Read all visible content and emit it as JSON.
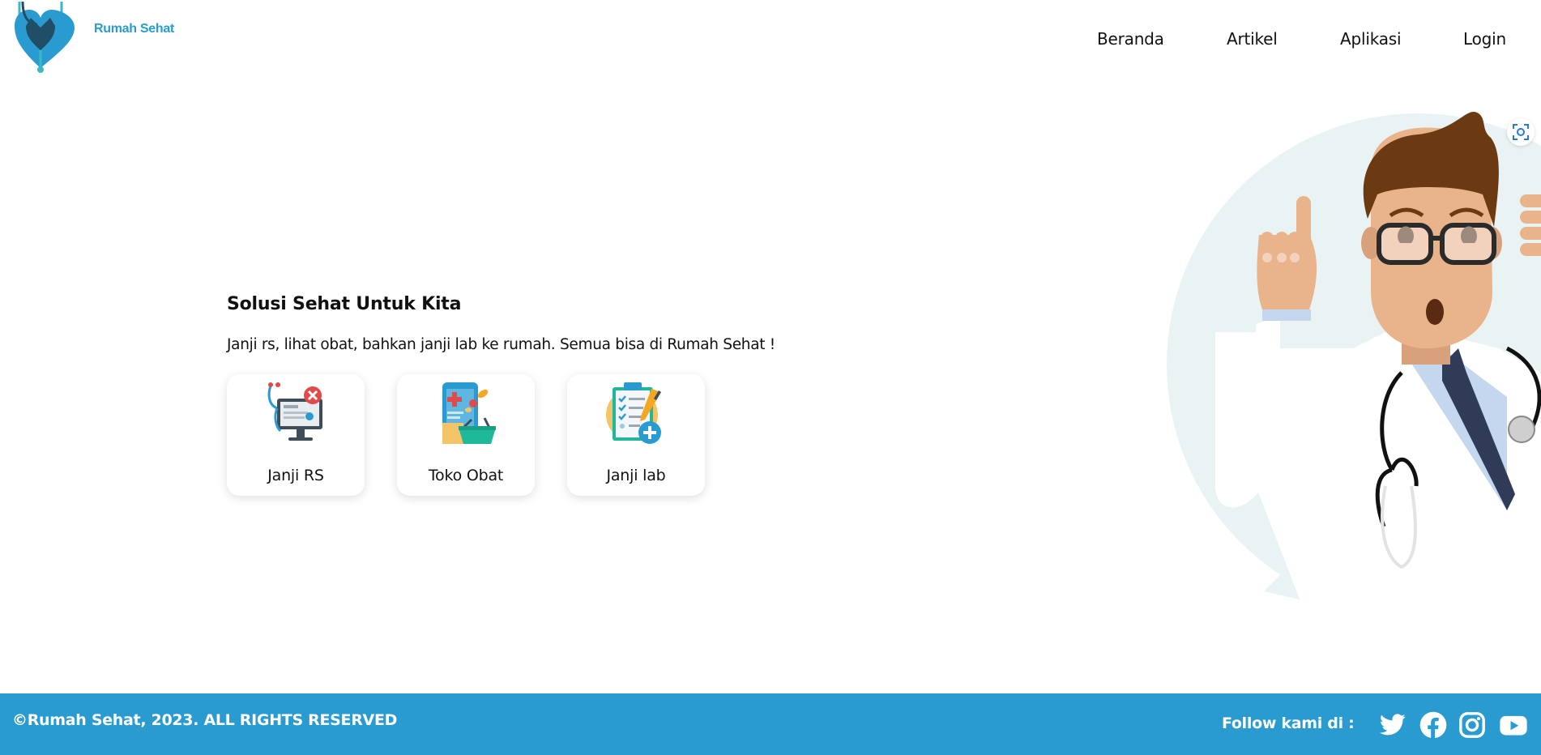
{
  "header": {
    "brand": "Rumah Sehat",
    "logo_icon": "heart-stethoscope-logo",
    "nav": [
      {
        "label": "Beranda"
      },
      {
        "label": "Artikel"
      },
      {
        "label": "Aplikasi"
      },
      {
        "label": "Login"
      }
    ]
  },
  "hero": {
    "title": "Solusi Sehat Untuk Kita",
    "subtitle": "Janji rs, lihat obat, bahkan janji lab ke rumah. Semua bisa di Rumah Sehat !",
    "illustration": "doctor-illustration",
    "services": [
      {
        "label": "Janji RS",
        "icon": "hospital-monitor-icon"
      },
      {
        "label": "Toko Obat",
        "icon": "pharmacy-basket-icon"
      },
      {
        "label": "Janji lab",
        "icon": "lab-clipboard-icon"
      }
    ]
  },
  "footer": {
    "copyright": "©Rumah Sehat, 2023. ALL RIGHTS RESERVED",
    "follow_label": "Follow kami di :",
    "social": [
      "twitter-icon",
      "facebook-icon",
      "instagram-icon",
      "youtube-icon"
    ]
  },
  "colors": {
    "brand": "#2a9bd1",
    "footer_bg": "#2a9bd1",
    "logo_dark": "#1f4e66",
    "logo_teal": "#3bb8c4"
  }
}
